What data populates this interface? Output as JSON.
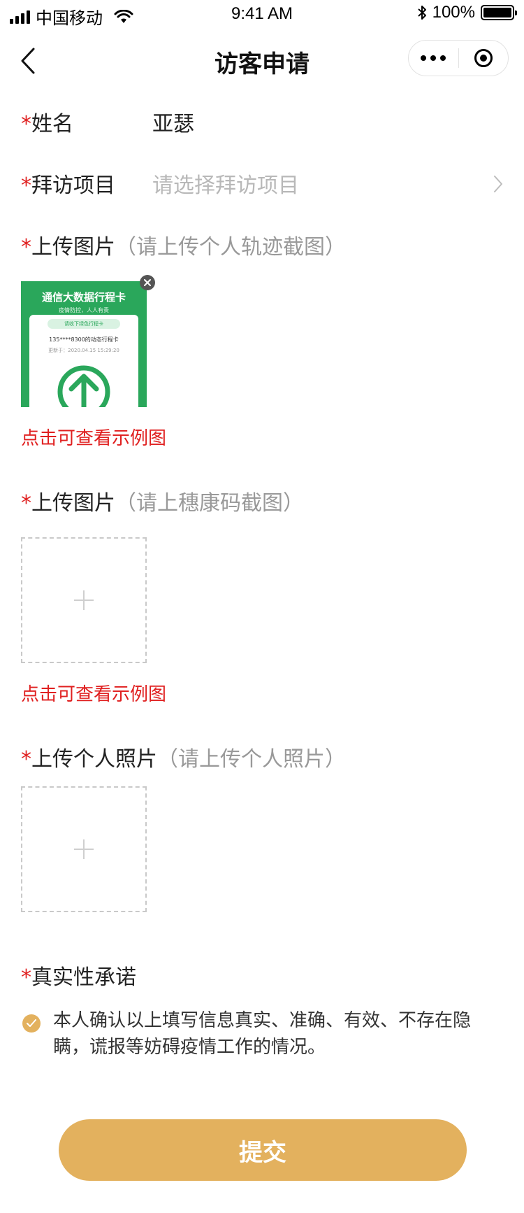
{
  "status_bar": {
    "carrier": "中国移动",
    "time": "9:41 AM",
    "battery": "100%"
  },
  "nav": {
    "title": "访客申请"
  },
  "form": {
    "required_mark": "*",
    "name_label": "姓名",
    "name_value": "亚瑟",
    "visit_label": "拜访项目",
    "visit_placeholder": "请选择拜访项目",
    "upload1_label": "上传图片",
    "upload1_hint": "（请上传个人轨迹截图）",
    "upload1_example_link": "点击可查看示例图",
    "upload2_label": "上传图片",
    "upload2_hint": "（请上穗康码截图）",
    "upload2_example_link": "点击可查看示例图",
    "upload3_label": "上传个人照片",
    "upload3_hint": "（请上传个人照片）",
    "commitment_label": "真实性承诺",
    "commitment_text": "本人确认以上填写信息真实、准确、有效、不存在隐瞒，谎报等妨碍疫情工作的情况。",
    "commitment_checked": true
  },
  "thumbnail": {
    "title": "通信大数据行程卡",
    "subtitle": "疫情防控，人人有责",
    "pill": "请收下绿色行程卡",
    "line1": "135****8300的动态行程卡",
    "line2": "更新于：2020.04.15 15:29:20"
  },
  "submit_label": "提交",
  "colors": {
    "accent": "#e3b15e",
    "required": "#e02020",
    "link": "#e02020",
    "thumb_green": "#2aa75b"
  }
}
